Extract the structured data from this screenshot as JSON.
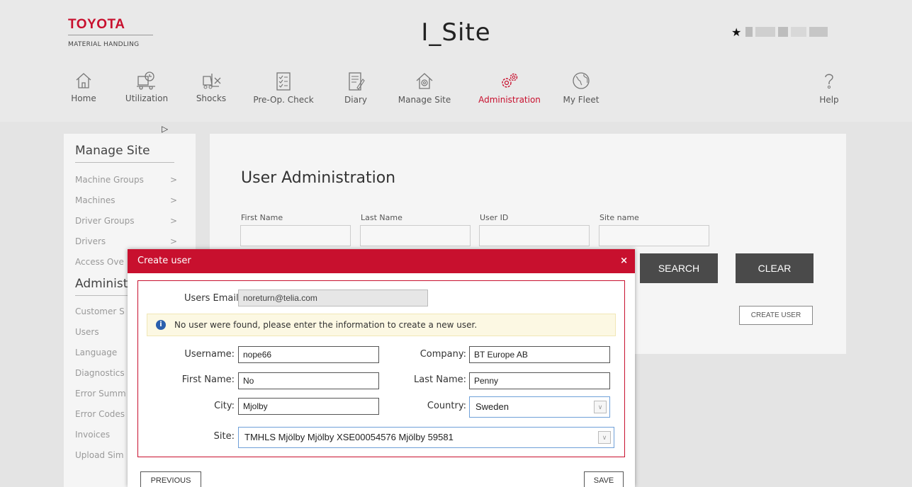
{
  "brand": {
    "name": "TOYOTA",
    "subtitle": "MATERIAL HANDLING"
  },
  "app_title": "I_Site",
  "header": {
    "favorite_icon": "star-icon"
  },
  "nav": {
    "items": [
      {
        "label": "Home",
        "icon": "home-icon"
      },
      {
        "label": "Utilization",
        "icon": "utilization-icon"
      },
      {
        "label": "Shocks",
        "icon": "shocks-icon"
      },
      {
        "label": "Pre-Op. Check",
        "icon": "checklist-icon"
      },
      {
        "label": "Diary",
        "icon": "diary-icon"
      },
      {
        "label": "Manage Site",
        "icon": "manage-site-icon"
      },
      {
        "label": "Administration",
        "icon": "gears-icon"
      },
      {
        "label": "My Fleet",
        "icon": "globe-icon"
      }
    ],
    "help": {
      "label": "Help",
      "icon": "question-icon"
    },
    "active": "Administration"
  },
  "sidebar": {
    "heading1": "Manage Site",
    "items1": [
      "Machine Groups",
      "Machines",
      "Driver Groups",
      "Drivers",
      "Access Ove"
    ],
    "heading2": "Administ",
    "items2": [
      "Customer S",
      "Users",
      "Language",
      "Diagnostics",
      "Error Summ",
      "Error Codes",
      "Invoices",
      "Upload Sim"
    ]
  },
  "main": {
    "title": "User Administration",
    "fields": {
      "first_name": "First Name",
      "last_name": "Last Name",
      "user_id": "User ID",
      "site_name": "Site name"
    },
    "search_label": "SEARCH",
    "clear_label": "CLEAR",
    "create_user_label": "CREATE USER"
  },
  "modal": {
    "title": "Create user",
    "close": "×",
    "email_label": "Users Email:",
    "email_value": "noreturn@telia.com",
    "info_text": "No user were found, please enter the information to create a new user.",
    "username_label": "Username:",
    "username_value": "nope66",
    "company_label": "Company:",
    "company_value": "BT Europe AB",
    "firstname_label": "First Name:",
    "firstname_value": "No",
    "lastname_label": "Last Name:",
    "lastname_value": "Penny",
    "city_label": "City:",
    "city_value": "Mjolby",
    "country_label": "Country:",
    "country_value": "Sweden",
    "site_label": "Site:",
    "site_value": "TMHLS Mjölby Mjölby XSE00054576 Mjölby 59581",
    "previous_label": "PREVIOUS",
    "save_label": "SAVE"
  },
  "colors": {
    "brand_red": "#c8102e",
    "button_dark": "#4a4a4a",
    "info_bg": "#fcf8e3"
  }
}
